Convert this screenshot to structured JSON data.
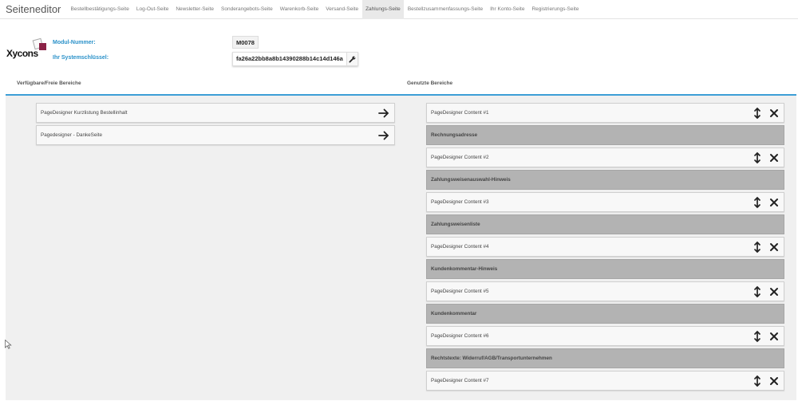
{
  "header": {
    "title": "Seiteneditor",
    "tabs": [
      {
        "label": "Bestellbestätigungs-Seite",
        "active": false
      },
      {
        "label": "Log-Out-Seite",
        "active": false
      },
      {
        "label": "Newsletter-Seite",
        "active": false
      },
      {
        "label": "Sonderangebots-Seite",
        "active": false
      },
      {
        "label": "Warenkorb-Seite",
        "active": false
      },
      {
        "label": "Versand-Seite",
        "active": false
      },
      {
        "label": "Zahlungs-Seite",
        "active": true
      },
      {
        "label": "Bestellzusammenfassungs-Seite",
        "active": false
      },
      {
        "label": "Ihr Konto-Seite",
        "active": false
      },
      {
        "label": "Registrierungs-Seite",
        "active": false
      }
    ]
  },
  "module": {
    "logo_text": "Xycons",
    "module_number_label": "Modul-Nummer:",
    "module_number": "M0078",
    "system_key_label": "Ihr Systemschlüssel:",
    "system_key": "fa26a22bb8a8b14390288b14c14d146a"
  },
  "available": {
    "title": "Verfügbare/Freie Bereiche",
    "items": [
      {
        "label": "PageDesigner Kurzlistung Bestellinhalt"
      },
      {
        "label": "Pagedesigner - DankeSeite"
      }
    ]
  },
  "used": {
    "title": "Genutzte Bereiche",
    "items": [
      {
        "label": "PageDesigner Content #1",
        "fixed": false
      },
      {
        "label": "Rechnungsadresse",
        "fixed": true
      },
      {
        "label": "PageDesigner Content #2",
        "fixed": false
      },
      {
        "label": "Zahlungsweisenauswahl-Hinweis",
        "fixed": true
      },
      {
        "label": "PageDesigner Content #3",
        "fixed": false
      },
      {
        "label": "Zahlungsweisenliste",
        "fixed": true
      },
      {
        "label": "PageDesigner Content #4",
        "fixed": false
      },
      {
        "label": "Kundenkommentar-Hinweis",
        "fixed": true
      },
      {
        "label": "PageDesigner Content #5",
        "fixed": false
      },
      {
        "label": "Kundenkommentar",
        "fixed": true
      },
      {
        "label": "PageDesigner Content #6",
        "fixed": false
      },
      {
        "label": "Rechtstexte: Widerruf/AGB/Transportunternehmen",
        "fixed": true
      },
      {
        "label": "PageDesigner Content #7",
        "fixed": false
      }
    ]
  },
  "icons": {
    "key_button": "wrench-icon",
    "add": "arrow-right-icon",
    "move": "up-down-arrow-icon",
    "delete": "close-icon"
  },
  "colors": {
    "accent": "#2a91c9",
    "divider": "#3d9ed6",
    "fixed_block": "#b3b3b3",
    "logo_cube": "#8b2246"
  }
}
